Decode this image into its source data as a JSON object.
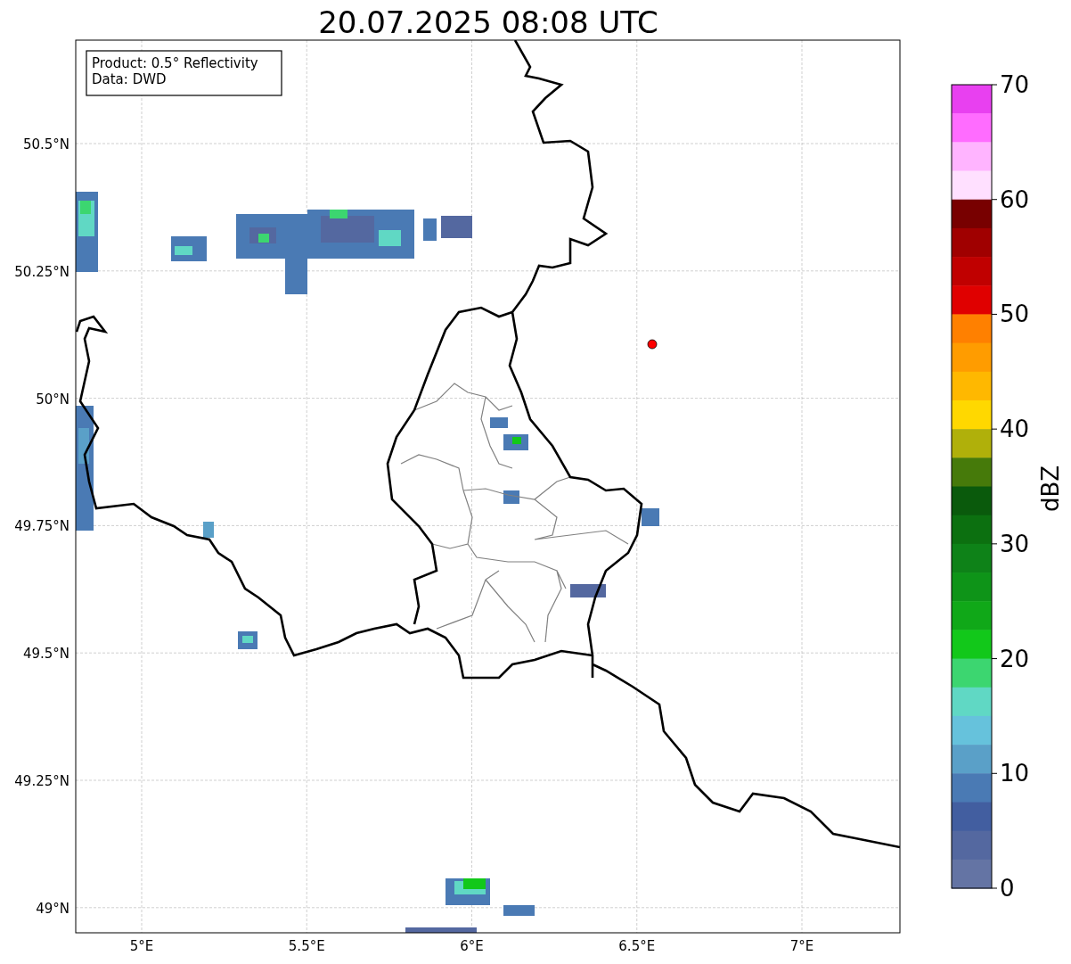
{
  "title": "20.07.2025 08:08 UTC",
  "legend": [
    "Product: 0.5° Reflectivity",
    "Data: DWD"
  ],
  "lat_ticks": [
    "50.5°N",
    "50.25°N",
    "50°N",
    "49.75°N",
    "49.5°N",
    "49.25°N",
    "49°N"
  ],
  "lon_ticks": [
    "5°E",
    "5.5°E",
    "6°E",
    "6.5°E",
    "7°E"
  ],
  "colorbar": {
    "label": "dBZ",
    "ticks": [
      "70",
      "60",
      "50",
      "40",
      "30",
      "20",
      "10",
      "0"
    ],
    "segments": [
      {
        "color": "#e840f0"
      },
      {
        "color": "#ff6cff"
      },
      {
        "color": "#ffb4ff"
      },
      {
        "color": "#ffe0ff"
      },
      {
        "color": "#780000"
      },
      {
        "color": "#a00000"
      },
      {
        "color": "#c00000"
      },
      {
        "color": "#e00000"
      },
      {
        "color": "#ff8000"
      },
      {
        "color": "#ff9c00"
      },
      {
        "color": "#ffb800"
      },
      {
        "color": "#ffd800"
      },
      {
        "color": "#b0b00a"
      },
      {
        "color": "#467a0a"
      },
      {
        "color": "#0a5a0c"
      },
      {
        "color": "#0c7010"
      },
      {
        "color": "#0e8218"
      },
      {
        "color": "#0e9418"
      },
      {
        "color": "#10a818"
      },
      {
        "color": "#12c81a"
      },
      {
        "color": "#3cd670"
      },
      {
        "color": "#60d8c4"
      },
      {
        "color": "#66c2dc"
      },
      {
        "color": "#5aa0c8"
      },
      {
        "color": "#4a7ab4"
      },
      {
        "color": "#425ea0"
      },
      {
        "color": "#5468a0"
      },
      {
        "color": "#6474a4"
      }
    ]
  }
}
